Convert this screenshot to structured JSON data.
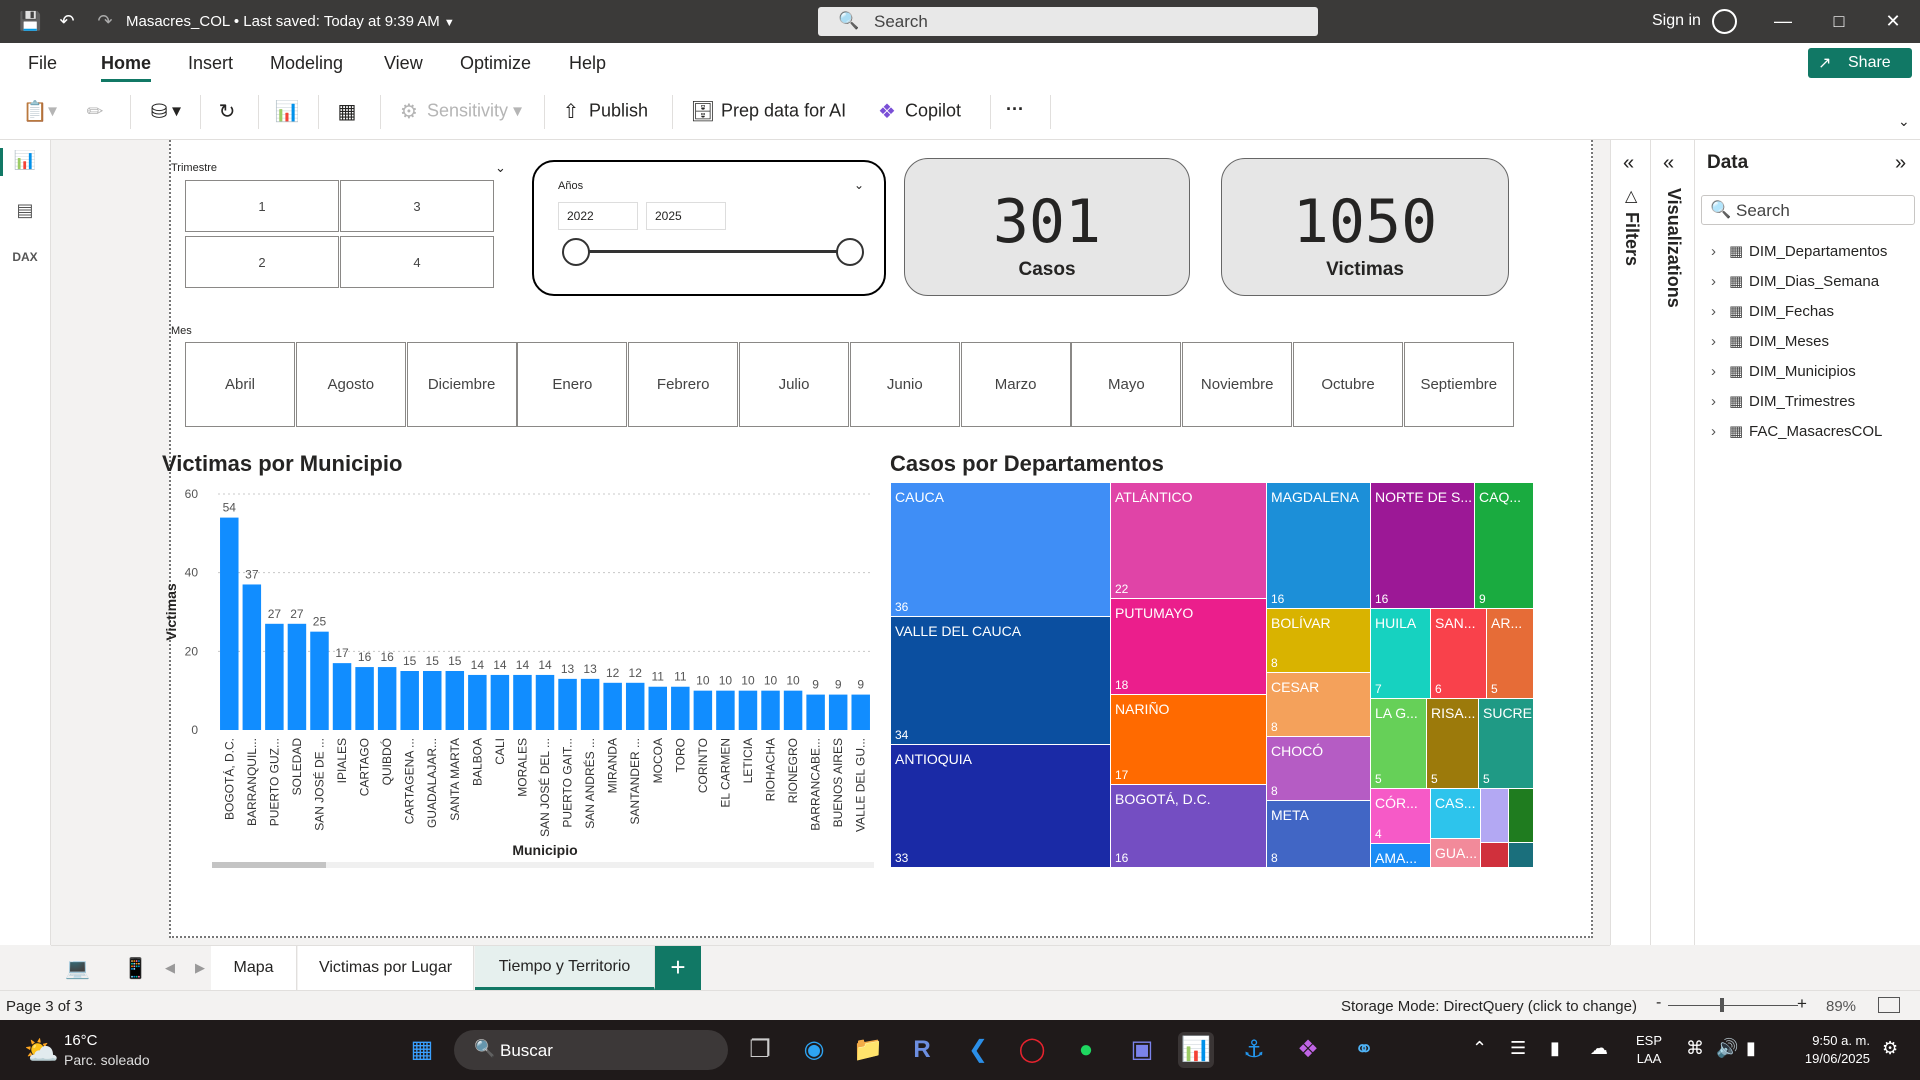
{
  "window": {
    "doc_title": "Masacres_COL • Last saved: Today at 9:39 AM",
    "search_placeholder": "Search",
    "signin": "Sign in"
  },
  "menu": [
    "File",
    "Home",
    "Insert",
    "Modeling",
    "View",
    "Optimize",
    "Help"
  ],
  "share_label": "Share",
  "ribbon": {
    "sensitivity": "Sensitivity",
    "publish": "Publish",
    "prep_data": "Prep data for AI",
    "copilot": "Copilot",
    "more": "···"
  },
  "slicers": {
    "trimestre_title": "Trimestre",
    "trimestre_values": [
      "1",
      "3",
      "2",
      "4"
    ],
    "anios_title": "Años",
    "anio_from": "2022",
    "anio_to": "2025",
    "mes_title": "Mes",
    "mes_values": [
      "Abril",
      "Agosto",
      "Diciembre",
      "Enero",
      "Febrero",
      "Julio",
      "Junio",
      "Marzo",
      "Mayo",
      "Noviembre",
      "Octubre",
      "Septiembre"
    ]
  },
  "kpis": {
    "casos_value": "301",
    "casos_label": "Casos",
    "victimas_value": "1050",
    "victimas_label": "Victimas"
  },
  "bar_title": "Victimas por Municipio",
  "treemap_title": "Casos por Departamentos",
  "chart_data": [
    {
      "type": "bar",
      "title": "Victimas por Municipio",
      "xlabel": "Municipio",
      "ylabel": "Victimas",
      "ylim": [
        0,
        60
      ],
      "yticks": [
        0,
        20,
        40,
        60
      ],
      "grid": true,
      "categories": [
        "BOGOTÁ, D.C.",
        "BARRANQUIL...",
        "PUERTO GUZ...",
        "SOLEDAD",
        "SAN JOSÉ DE ...",
        "IPIALES",
        "CARTAGO",
        "QUIBDÓ",
        "CARTAGENA ...",
        "GUADALAJAR...",
        "SANTA MARTA",
        "BALBOA",
        "CALI",
        "MORALES",
        "SAN JOSÉ DEL ...",
        "PUERTO GAIT...",
        "SAN ANDRÉS ...",
        "MIRANDA",
        "SANTANDER ...",
        "MOCOA",
        "TORO",
        "CORINTO",
        "EL CARMEN",
        "LETICIA",
        "RIOHACHA",
        "RIONEGRO",
        "BARRANCABE...",
        "BUENOS AIRES",
        "VALLE DEL GU..."
      ],
      "values": [
        54,
        37,
        27,
        27,
        25,
        17,
        16,
        16,
        15,
        15,
        15,
        14,
        14,
        14,
        14,
        13,
        13,
        12,
        12,
        11,
        11,
        10,
        10,
        10,
        10,
        10,
        9,
        9,
        9
      ],
      "color": "#118dff"
    },
    {
      "type": "treemap",
      "title": "Casos por Departamentos",
      "items": [
        {
          "name": "CAUCA",
          "value": 36,
          "color": "#3f8ef6"
        },
        {
          "name": "VALLE DEL CAUCA",
          "value": 34,
          "color": "#0b4fa0"
        },
        {
          "name": "ANTIOQUIA",
          "value": 33,
          "color": "#1a2aa6"
        },
        {
          "name": "ATLÁNTICO",
          "value": 22,
          "color": "#e044a7"
        },
        {
          "name": "PUTUMAYO",
          "value": 18,
          "color": "#eb1e8c"
        },
        {
          "name": "NARIÑO",
          "value": 17,
          "color": "#ff6a00"
        },
        {
          "name": "BOGOTÁ, D.C.",
          "value": 16,
          "color": "#744ec2"
        },
        {
          "name": "MAGDALENA",
          "value": 16,
          "color": "#1c8fd8"
        },
        {
          "name": "NORTE DE S...",
          "value": 16,
          "color": "#9c1896"
        },
        {
          "name": "CAQ...",
          "value": 9,
          "color": "#1aab40"
        },
        {
          "name": "BOLÍVAR",
          "value": 8,
          "color": "#d9b300"
        },
        {
          "name": "CESAR",
          "value": 8,
          "color": "#f4a15b"
        },
        {
          "name": "CHOCÓ",
          "value": 8,
          "color": "#b55cc4"
        },
        {
          "name": "META",
          "value": 8,
          "color": "#4166c5"
        },
        {
          "name": "HUILA",
          "value": 7,
          "color": "#16d2c0"
        },
        {
          "name": "SAN...",
          "value": 6,
          "color": "#f9414b"
        },
        {
          "name": "AR...",
          "value": 5,
          "color": "#e66c37"
        },
        {
          "name": "LA G...",
          "value": 5,
          "color": "#66d058"
        },
        {
          "name": "RISA...",
          "value": 5,
          "color": "#9c7a0b"
        },
        {
          "name": "SUCRE",
          "value": 5,
          "color": "#1f9a85"
        },
        {
          "name": "CÓR...",
          "value": 4,
          "color": "#f65ac7"
        },
        {
          "name": "CAS...",
          "value": null,
          "color": "#2dc4ec"
        },
        {
          "name": "AMA...",
          "value": null,
          "color": "#1b8cf5"
        },
        {
          "name": "GUA...",
          "value": null,
          "color": "#f28a9a"
        },
        {
          "name": "",
          "value": null,
          "color": "#b3a8f3"
        },
        {
          "name": "",
          "value": null,
          "color": "#1f7c1f"
        },
        {
          "name": "",
          "value": null,
          "color": "#d0303c"
        },
        {
          "name": "",
          "value": null,
          "color": "#1a6f7c"
        }
      ]
    }
  ],
  "panes": {
    "filters": "Filters",
    "visualizations": "Visualizations",
    "data_title": "Data",
    "data_search": "Search",
    "tables": [
      "DIM_Departamentos",
      "DIM_Dias_Semana",
      "DIM_Fechas",
      "DIM_Meses",
      "DIM_Municipios",
      "DIM_Trimestres",
      "FAC_MasacresCOL"
    ]
  },
  "tabs": [
    "Mapa",
    "Victimas por Lugar",
    "Tiempo y Territorio"
  ],
  "status": {
    "page": "Page 3 of 3",
    "storage": "Storage Mode: DirectQuery (click to change)",
    "zoom": "89%"
  },
  "taskbar": {
    "temp": "16°C",
    "weather": "Parc. soleado",
    "search": "Buscar",
    "lang1": "ESP",
    "lang2": "LAA",
    "time": "9:50 a. m.",
    "date": "19/06/2025"
  },
  "colors": {
    "accent": "#117865",
    "titlebar": "#3b3a39",
    "bar": "#118dff"
  }
}
